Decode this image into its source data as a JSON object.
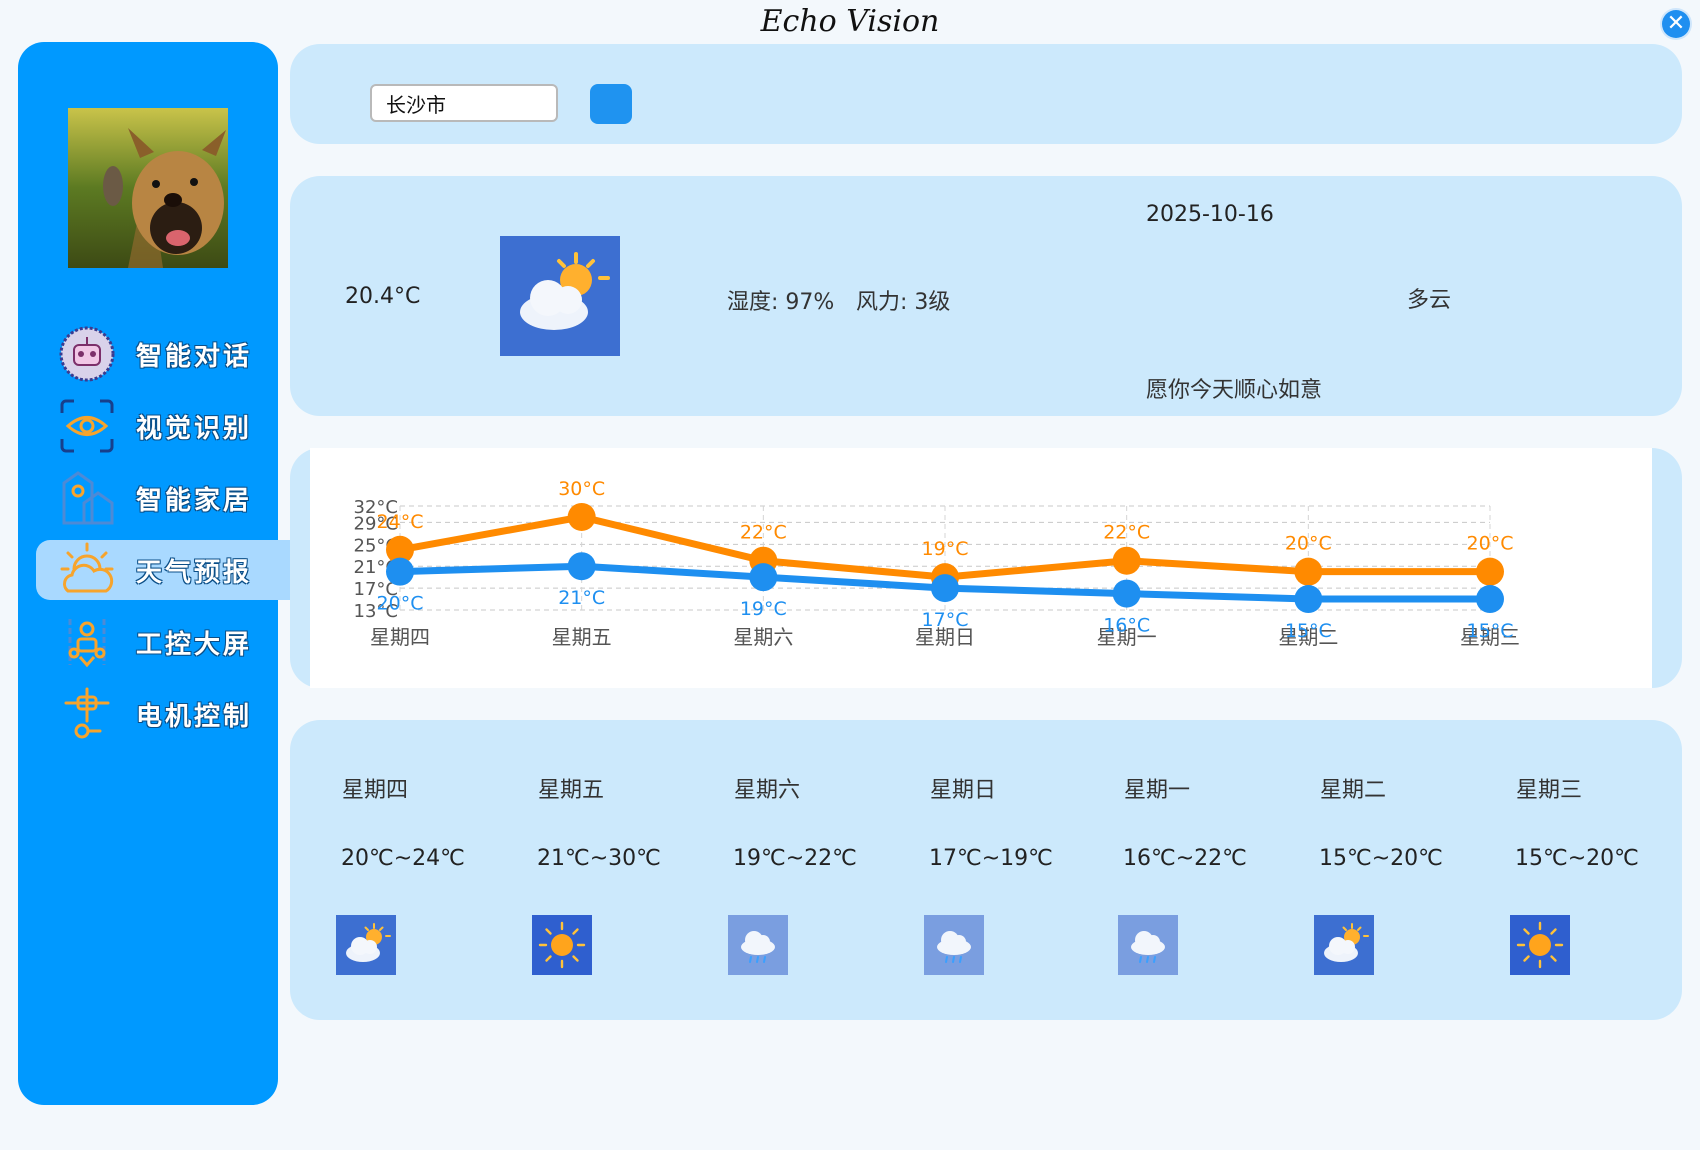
{
  "window": {
    "title": "Echo Vision",
    "close_label": "✕"
  },
  "sidebar": {
    "items": [
      {
        "label": "智能对话",
        "icon": "robot-chat-icon",
        "active": false
      },
      {
        "label": "视觉识别",
        "icon": "eye-scan-icon",
        "active": false
      },
      {
        "label": "智能家居",
        "icon": "smart-home-icon",
        "active": false
      },
      {
        "label": "天气预报",
        "icon": "weather-icon",
        "active": true
      },
      {
        "label": "工控大屏",
        "icon": "industrial-screen-icon",
        "active": false
      },
      {
        "label": "电机控制",
        "icon": "motor-control-icon",
        "active": false
      }
    ]
  },
  "search": {
    "value": "长沙市"
  },
  "today": {
    "temperature": "20.4°C",
    "humidity": "湿度: 97%",
    "wind": "风力: 3级",
    "date": "2025-10-16",
    "condition": "多云",
    "wish": "愿你今天顺心如意",
    "icon": "partly-cloudy-icon"
  },
  "chart_data": {
    "type": "line",
    "categories": [
      "星期四",
      "星期五",
      "星期六",
      "星期日",
      "星期一",
      "星期二",
      "星期三"
    ],
    "series": [
      {
        "name": "",
        "values": [
          24,
          30,
          22,
          19,
          22,
          20,
          20
        ],
        "color": "#ff8a00",
        "labels": [
          "24°C",
          "30°C",
          "22°C",
          "19°C",
          "22°C",
          "20°C",
          "20°C"
        ]
      },
      {
        "name": "",
        "values": [
          20,
          21,
          19,
          17,
          16,
          15,
          15
        ],
        "color": "#1e8ff0",
        "labels": [
          "20°C",
          "21°C",
          "19°C",
          "17°C",
          "16°C",
          "15°C",
          "15°C"
        ]
      }
    ],
    "y_ticks": [
      "13°C",
      "17°C",
      "21°C",
      "25°C",
      "29°C",
      "32°C"
    ],
    "y_tick_values": [
      13,
      17,
      21,
      25,
      29,
      32
    ],
    "ylim": [
      13,
      32
    ],
    "grid": true,
    "legend": false
  },
  "forecast": [
    {
      "day": "星期四",
      "range": "20℃~24℃",
      "icon": "partly-cloudy-icon"
    },
    {
      "day": "星期五",
      "range": "21℃~30℃",
      "icon": "sunny-icon"
    },
    {
      "day": "星期六",
      "range": "19℃~22℃",
      "icon": "rain-cloud-icon"
    },
    {
      "day": "星期日",
      "range": "17℃~19℃",
      "icon": "rain-cloud-icon"
    },
    {
      "day": "星期一",
      "range": "16℃~22℃",
      "icon": "rain-cloud-icon"
    },
    {
      "day": "星期二",
      "range": "15℃~20℃",
      "icon": "partly-cloudy-icon"
    },
    {
      "day": "星期三",
      "range": "15℃~20℃",
      "icon": "sunny-icon"
    }
  ],
  "colors": {
    "sidebar": "#0099ff",
    "card": "#cce9fc",
    "accent": "#1f93f0",
    "high": "#ff8a00",
    "low": "#1e8ff0"
  }
}
